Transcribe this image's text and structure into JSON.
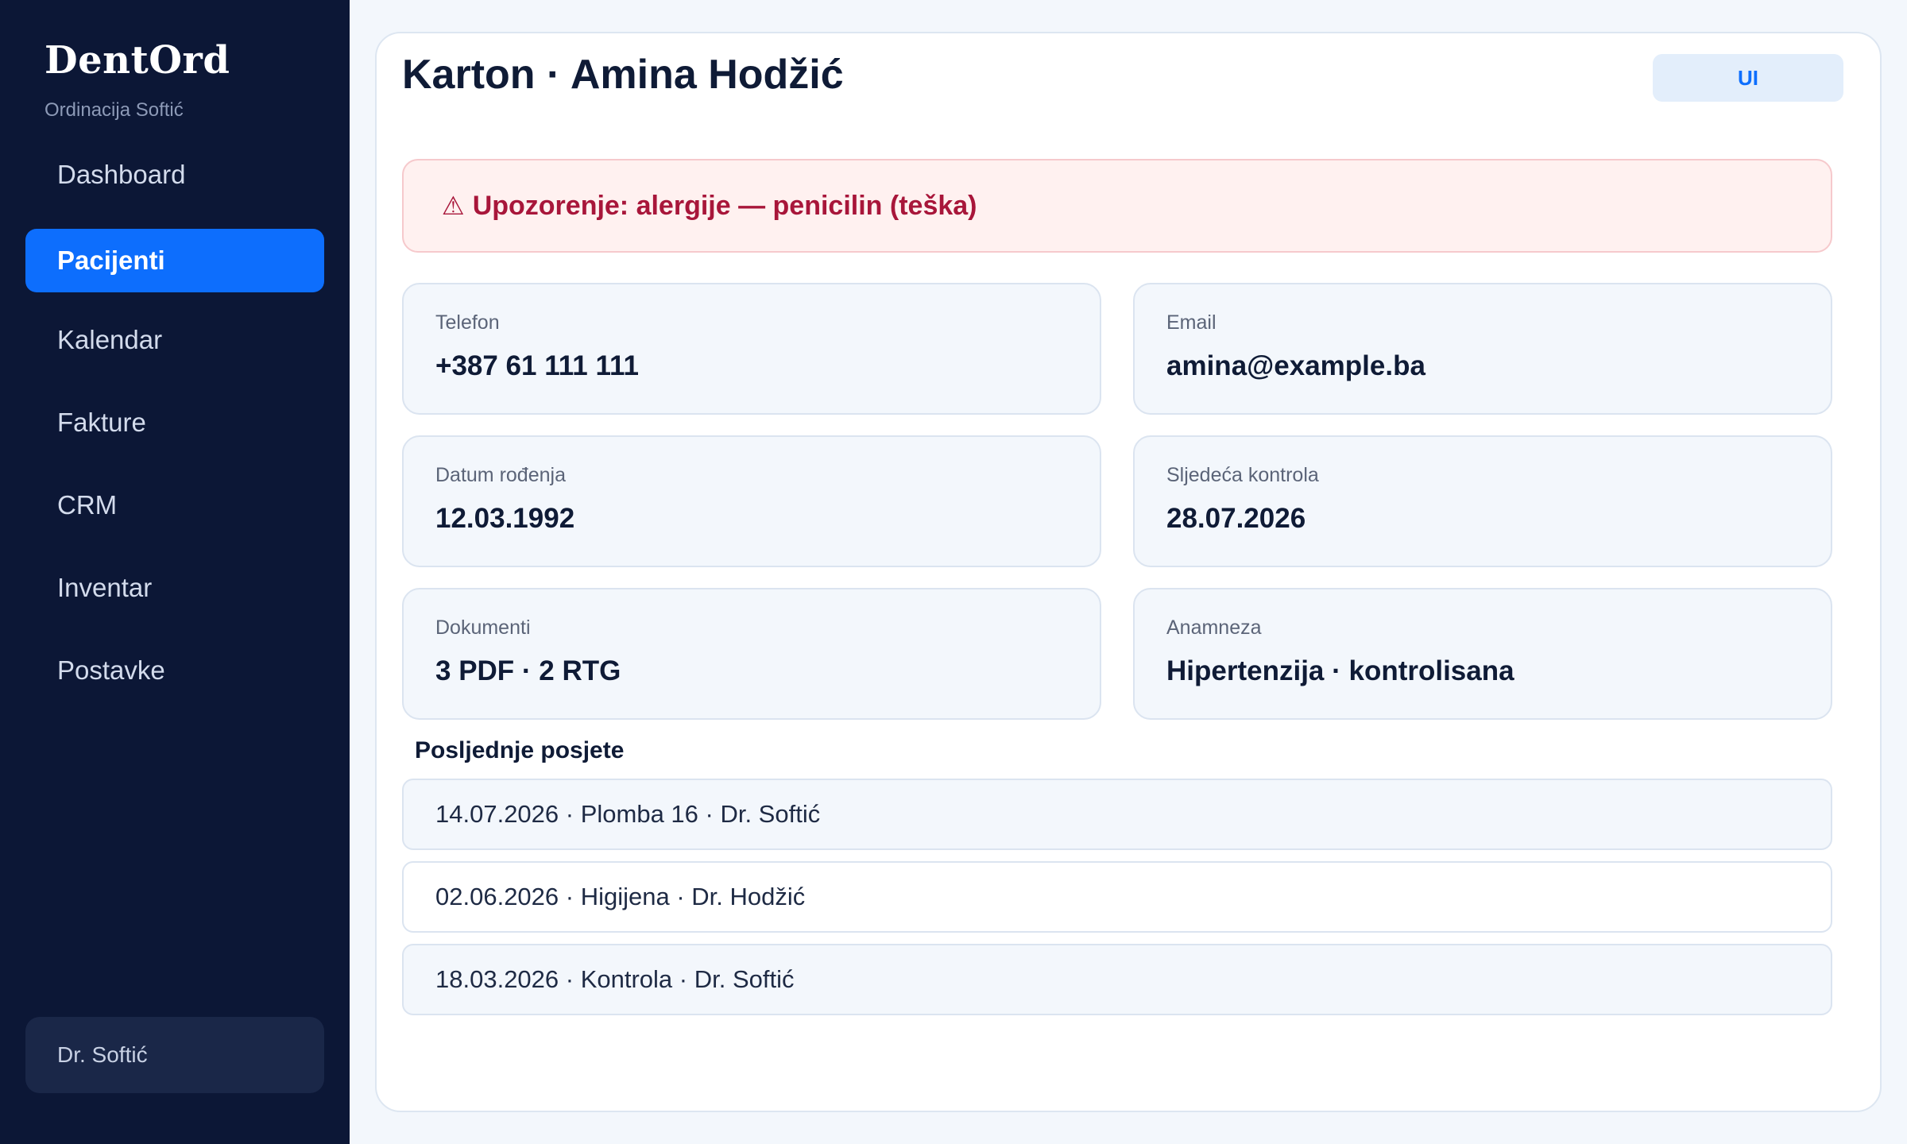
{
  "app": {
    "brand": "DentOrd",
    "subtitle": "Ordinacija Softić"
  },
  "sidebar": {
    "items": [
      {
        "label": "Dashboard",
        "active": false
      },
      {
        "label": "Pacijenti",
        "active": true
      },
      {
        "label": "Kalendar",
        "active": false
      },
      {
        "label": "Fakture",
        "active": false
      },
      {
        "label": "CRM",
        "active": false
      },
      {
        "label": "Inventar",
        "active": false
      },
      {
        "label": "Postavke",
        "active": false
      }
    ],
    "user": "Dr. Softić"
  },
  "header": {
    "title": "Karton · Amina Hodžić",
    "chip_label": "UI"
  },
  "alert": {
    "icon": "warning-icon",
    "text": "Upozorenje: alergije — penicilin (teška)"
  },
  "fields": [
    {
      "label": "Telefon",
      "value": "+387 61 111 111"
    },
    {
      "label": "Email",
      "value": "amina@example.ba"
    },
    {
      "label": "Datum rođenja",
      "value": "12.03.1992"
    },
    {
      "label": "Sljedeća kontrola",
      "value": "28.07.2026"
    },
    {
      "label": "Dokumenti",
      "value": "3 PDF · 2 RTG"
    },
    {
      "label": "Anamneza",
      "value": "Hipertenzija · kontrolisana"
    }
  ],
  "visits": {
    "title": "Posljednje posjete",
    "items": [
      "14.07.2026 · Plomba 16 · Dr. Softić",
      "02.06.2026 · Higijena · Dr. Hodžić",
      "18.03.2026 · Kontrola · Dr. Softić"
    ]
  },
  "colors": {
    "sidebar_bg": "#0c1736",
    "accent": "#0d6efd",
    "alert_text": "#a8163a",
    "alert_bg": "#fff1f0"
  }
}
